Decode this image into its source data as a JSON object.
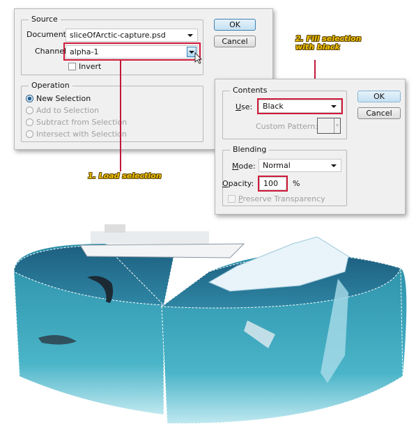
{
  "load_dialog": {
    "source_title": "Source",
    "document_label": "Document:",
    "document_value": "sliceOfArctic-capture.psd",
    "channel_label": "Channel:",
    "channel_value": "alpha-1",
    "invert_label": "Invert",
    "invert_checked": false,
    "operation_title": "Operation",
    "operations": [
      {
        "label": "New Selection",
        "selected": true,
        "enabled": true
      },
      {
        "label": "Add to Selection",
        "selected": false,
        "enabled": false
      },
      {
        "label": "Subtract from Selection",
        "selected": false,
        "enabled": false
      },
      {
        "label": "Intersect with Selection",
        "selected": false,
        "enabled": false
      }
    ],
    "ok": "OK",
    "cancel": "Cancel"
  },
  "fill_dialog": {
    "contents_title": "Contents",
    "use_label": "Use:",
    "use_value": "Black",
    "custom_pattern_label": "Custom Pattern:",
    "blending_title": "Blending",
    "mode_label": "Mode:",
    "mode_value": "Normal",
    "opacity_label": "Opacity:",
    "opacity_value": "100",
    "opacity_unit": "%",
    "preserve_label": "Preserve Transparency",
    "preserve_checked": false,
    "ok": "OK",
    "cancel": "Cancel"
  },
  "annotations": {
    "step1": "1. Load selection",
    "step2_line1": "2. Fill selection",
    "step2_line2": "with black"
  },
  "colors": {
    "highlight": "#d01a3a",
    "annotation": "#f2c300",
    "water": "#3aa0b8"
  }
}
